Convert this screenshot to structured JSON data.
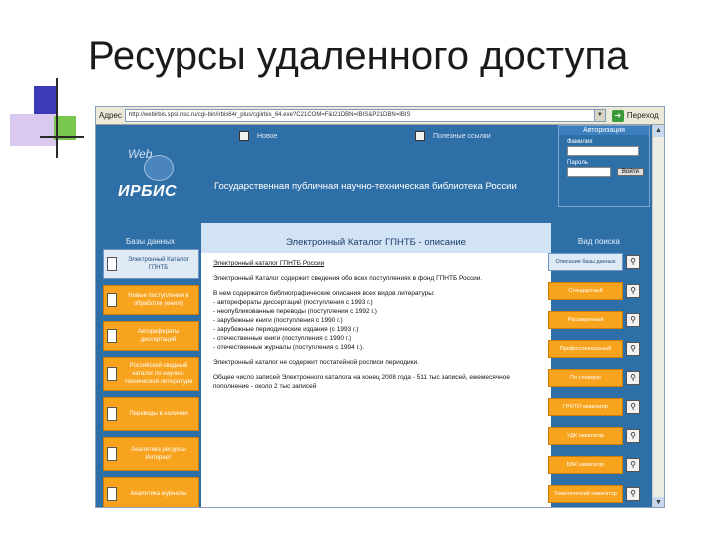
{
  "slide": {
    "title": "Ресурсы удаленного доступа"
  },
  "browser": {
    "address_label": "Адрес",
    "url": "http://webirbis.spsl.nsc.ru/cgi-bin/irbis64r_plus/cgiirbis_64.exe?C21COM=F&I21DBN=IBIS&P21DBN=IBIS",
    "go_label": "Переход"
  },
  "header": {
    "top_links": [
      "Новое",
      "Полезные ссылки"
    ],
    "logo_web": "Web",
    "logo_irbis": "ИРБИС",
    "library_name": "Государственная публичная научно-техническая библиотека России"
  },
  "auth": {
    "title": "Авторизация",
    "surname_label": "Фамилия",
    "password_label": "Пароль",
    "submit_label": "Войти"
  },
  "left_column": {
    "title": "Базы данных",
    "items": [
      "Электронный Каталог ГПНТБ",
      "Новые поступления в обработке (книги)",
      "Авторефераты диссертаций",
      "Российский сводный каталог по научно-технической литературе",
      "Переводы в наличии",
      "Аналитика ресурсы Интернет",
      "Аналитика журналы"
    ]
  },
  "center": {
    "title": "Электронный Каталог ГПНТБ - описание",
    "catalog_title": "Электронный каталог ГПНТБ России",
    "intro": "Электронный Каталог содержит сведения обо всех поступлениях в фонд ГПНТБ России.",
    "contents_intro": "В нем содержатся библиографические описания всех видов литературы:",
    "types": [
      "- авторефераты диссертаций (поступления с 1993 г.)",
      "- неопубликованные переводы (поступления с 1992 г.)",
      "- зарубежные книги (поступления с 1990 г.)",
      "- зарубежные периодические издания (с 1993 г.)",
      "- отечественные книги (поступления с 1990 г.)",
      "- отечественные журналы (поступления с 1994 г.)."
    ],
    "note": "Электронный каталог не содержит постатейной росписи периодики.",
    "total": "Общее число записей Электронного каталога на конец 2008 года - 511 тыс записей, ежемесячное пополнение - около 2 тыс записей"
  },
  "right_column": {
    "title": "Вид поиска",
    "items": [
      "Описание базы данных",
      "Стандартный",
      "Расширенный",
      "Профессиональный",
      "По словарю",
      "ГРНТИ навигатор",
      "УДК навигатор",
      "ББК навигатор",
      "Тематический навигатор"
    ],
    "active_index": 0
  },
  "colors": {
    "page_blue": "#2f6fa8",
    "nav_orange": "#f7a31e",
    "panel_light": "#d2e3f5"
  }
}
